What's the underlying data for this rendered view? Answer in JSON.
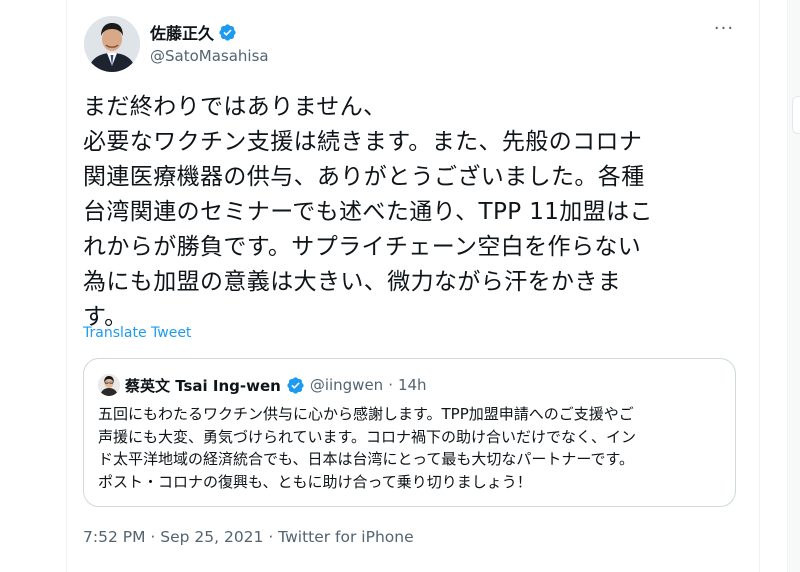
{
  "tweet": {
    "author": {
      "name": "佐藤正久",
      "handle": "@SatoMasahisa",
      "avatar_icon": "avatar-portrait-icon"
    },
    "more_label": "···",
    "text": "まだ終わりではありません、\n必要なワクチン支援は続きます。また、先般のコロナ\n関連医療機器の供与、ありがとうございました。各種\n台湾関連のセミナーでも述べた通り、TPP 11加盟はこ\nれからが勝負です。サプライチェーン空白を作らない\n為にも加盟の意義は大きい、微力ながら汗をかきま\nす。",
    "translate_label": "Translate Tweet",
    "quoted": {
      "name": "蔡英文 Tsai Ing-wen",
      "handle": "@iingwen",
      "separator": "·",
      "time": "14h",
      "text": "五回にもわたるワクチン供与に心から感謝します。TPP加盟申請へのご支援やご\n声援にも大変、勇気づけられています。コロナ禍下の助け合いだけでなく、イン\nド太平洋地域の経済統合でも、日本は台湾にとって最も大切なパートナーです。\nポスト・コロナの復興も、ともに助け合って乗り切りましょう！"
    },
    "timestamp": "7:52 PM · Sep 25, 2021 · Twitter for iPhone"
  },
  "colors": {
    "accent": "#1d9bf0",
    "text_primary": "#0f1419",
    "text_secondary": "#536471",
    "border": "#cfd9de"
  }
}
